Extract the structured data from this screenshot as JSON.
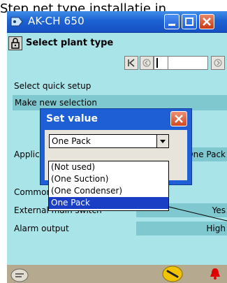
{
  "caption": "Step net type installatie in",
  "window": {
    "title": "AK-CH 650",
    "min_icon": "minimize-icon",
    "max_icon": "maximize-icon",
    "close_icon": "close-icon"
  },
  "header": {
    "lock_icon": "lock-icon",
    "title": "Select plant type"
  },
  "navigation": {
    "first_icon": "first-page-icon",
    "prev_icon": "previous-icon",
    "next_icon": "next-icon"
  },
  "quick_setup": {
    "label": "Select quick setup",
    "value": "Make new selection"
  },
  "rows": [
    {
      "label": "Application",
      "value": "One Pack"
    },
    {
      "label": "Common",
      "value": ""
    },
    {
      "label": "External main switch",
      "value": "Yes"
    },
    {
      "label": "Alarm output",
      "value": "High"
    }
  ],
  "dialog": {
    "title": "Set value",
    "current_value": "One Pack",
    "options": [
      "(Not used)",
      "(One Suction)",
      "(One Condenser)",
      "One Pack"
    ],
    "selected_index": 3,
    "close_icon": "close-icon"
  },
  "bottom": {
    "left_icon": "device-icon",
    "tool_icon": "wrench-icon",
    "alarm_icon": "alarm-bell-icon"
  },
  "colors": {
    "titlebar": "#1d62d3",
    "background": "#a9e4e9",
    "value_field": "#7fc8cf",
    "selection": "#1a3ec4",
    "close_button": "#d24a22"
  }
}
